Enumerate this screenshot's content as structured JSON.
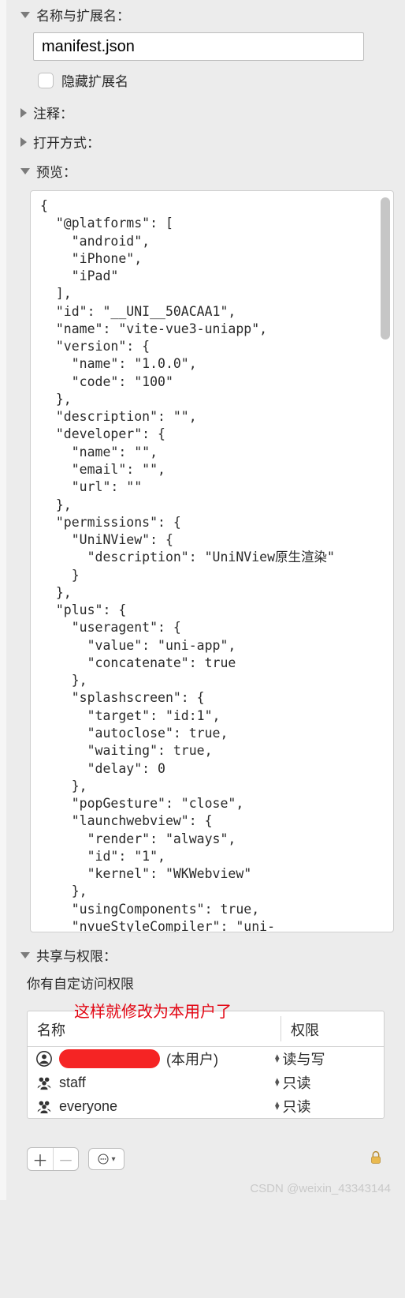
{
  "header": {
    "name_ext_label": "名称与扩展名：",
    "filename": "manifest.json",
    "hide_ext_label": "隐藏扩展名"
  },
  "sections": {
    "comments": "注释：",
    "open_with": "打开方式：",
    "preview": "预览：",
    "sharing": "共享与权限："
  },
  "preview_text": "{\n  \"@platforms\": [\n    \"android\",\n    \"iPhone\",\n    \"iPad\"\n  ],\n  \"id\": \"__UNI__50ACAA1\",\n  \"name\": \"vite-vue3-uniapp\",\n  \"version\": {\n    \"name\": \"1.0.0\",\n    \"code\": \"100\"\n  },\n  \"description\": \"\",\n  \"developer\": {\n    \"name\": \"\",\n    \"email\": \"\",\n    \"url\": \"\"\n  },\n  \"permissions\": {\n    \"UniNView\": {\n      \"description\": \"UniNView原生渲染\"\n    }\n  },\n  \"plus\": {\n    \"useragent\": {\n      \"value\": \"uni-app\",\n      \"concatenate\": true\n    },\n    \"splashscreen\": {\n      \"target\": \"id:1\",\n      \"autoclose\": true,\n      \"waiting\": true,\n      \"delay\": 0\n    },\n    \"popGesture\": \"close\",\n    \"launchwebview\": {\n      \"render\": \"always\",\n      \"id\": \"1\",\n      \"kernel\": \"WKWebview\"\n    },\n    \"usingComponents\": true,\n    \"nvueStyleCompiler\": \"uni-",
  "sharing": {
    "desc": "你有自定访问权限",
    "note": "这样就修改为本用户了",
    "col_name": "名称",
    "col_perm": "权限",
    "rows": [
      {
        "name_suffix": "(本用户)",
        "perm": "读与写"
      },
      {
        "name": "staff",
        "perm": "只读"
      },
      {
        "name": "everyone",
        "perm": "只读"
      }
    ]
  },
  "watermark": "CSDN @weixin_43343144"
}
